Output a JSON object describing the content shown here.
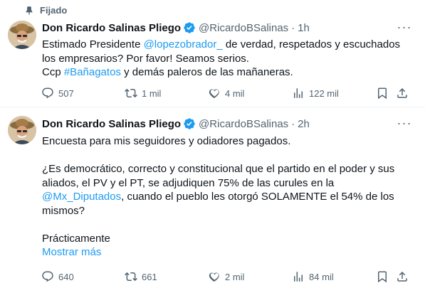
{
  "pinned": {
    "label": "Fijado",
    "icon": "pin-icon"
  },
  "tweets": [
    {
      "name": "Don Ricardo Salinas Pliego",
      "handle": "@RicardoBSalinas",
      "dot": "·",
      "time": "1h",
      "text": {
        "l1_pre": "Estimado Presidente ",
        "l1_mention": "@lopezobrador_",
        "l1_post": " de verdad, respetados y escuchados",
        "l2": "los empresarios? Por favor! Seamos serios.",
        "l3_pre": "Ccp ",
        "l3_hashtag": "#Bañagatos",
        "l3_post": " y demás paleros de las mañaneras."
      },
      "stats": {
        "replies": "507",
        "retweets": "1 mil",
        "likes": "4 mil",
        "views": "122 mil"
      }
    },
    {
      "name": "Don Ricardo Salinas Pliego",
      "handle": "@RicardoBSalinas",
      "dot": "·",
      "time": "2h",
      "text": {
        "l1": "Encuesta para mis seguidores y odiadores pagados.",
        "l3": "¿Es democrático, correcto y constitucional que el partido en el poder y sus",
        "l4": "aliados, el PV y el PT, se adjudiquen 75% de las curules en la",
        "l5_mention": "@Mx_Diputados",
        "l5_post": ", cuando el pueblo les otorgó SOLAMENTE el 54% de los",
        "l6": "mismos?",
        "l8": "Prácticamente",
        "show_more": "Mostrar más"
      },
      "stats": {
        "replies": "640",
        "retweets": "661",
        "likes": "2 mil",
        "views": "84 mil"
      }
    }
  ],
  "colors": {
    "accent": "#1d9bf0",
    "muted": "#536471",
    "text": "#0f1419",
    "divider": "#eff3f4"
  }
}
